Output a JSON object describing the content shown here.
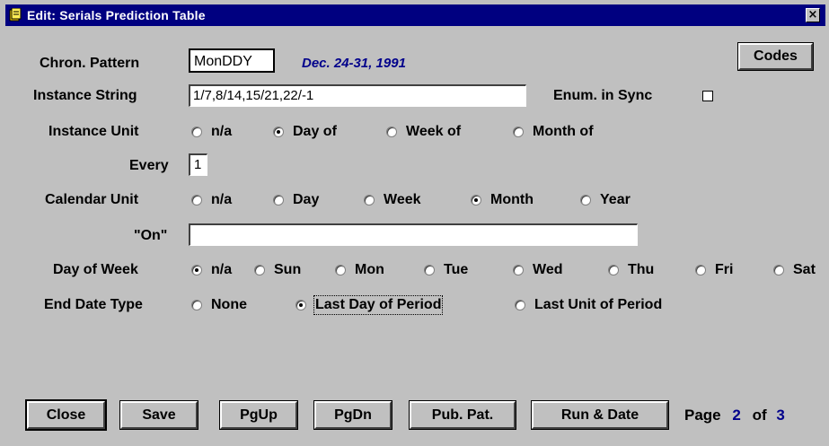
{
  "window": {
    "title": "Edit: Serials Prediction Table",
    "close_glyph": "×"
  },
  "labels": {
    "chron_pattern": "Chron. Pattern",
    "instance_string": "Instance String",
    "instance_unit": "Instance Unit",
    "every": "Every",
    "calendar_unit": "Calendar Unit",
    "on": "\"On\"",
    "day_of_week": "Day of Week",
    "end_date_type": "End Date Type",
    "enum_in_sync": "Enum. in Sync"
  },
  "fields": {
    "chron_pattern": "MonDDY",
    "chron_date": "Dec. 24-31, 1991",
    "instance_string": "1/7,8/14,15/21,22/-1",
    "every": "1",
    "on": ""
  },
  "enum_in_sync": false,
  "instance_unit": {
    "options": [
      "n/a",
      "Day of",
      "Week of",
      "Month of"
    ],
    "selected": "Day of"
  },
  "calendar_unit": {
    "options": [
      "n/a",
      "Day",
      "Week",
      "Month",
      "Year"
    ],
    "selected": "Month"
  },
  "day_of_week": {
    "options": [
      "n/a",
      "Sun",
      "Mon",
      "Tue",
      "Wed",
      "Thu",
      "Fri",
      "Sat"
    ],
    "selected": "n/a"
  },
  "end_date_type": {
    "options": [
      "None",
      "Last Day of Period",
      "Last Unit of Period"
    ],
    "selected": "Last Day of Period"
  },
  "buttons": {
    "codes": "Codes",
    "close": "Close",
    "save": "Save",
    "pgup": "PgUp",
    "pgdn": "PgDn",
    "pub_pat": "Pub. Pat.",
    "run_date": "Run & Date"
  },
  "pager": {
    "page_label": "Page",
    "current": "2",
    "of_label": "of",
    "total": "3"
  }
}
